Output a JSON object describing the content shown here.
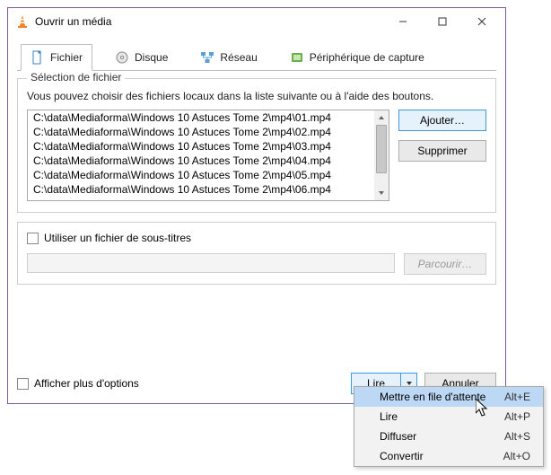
{
  "window": {
    "title": "Ouvrir un média"
  },
  "tabs": {
    "file": "Fichier",
    "disc": "Disque",
    "network": "Réseau",
    "capture": "Périphérique de capture"
  },
  "file_section": {
    "legend": "Sélection de fichier",
    "hint": "Vous pouvez choisir des fichiers locaux dans la liste suivante ou à l'aide des boutons.",
    "items": [
      "C:\\data\\Mediaforma\\Windows 10 Astuces Tome 2\\mp4\\01.mp4",
      "C:\\data\\Mediaforma\\Windows 10 Astuces Tome 2\\mp4\\02.mp4",
      "C:\\data\\Mediaforma\\Windows 10 Astuces Tome 2\\mp4\\03.mp4",
      "C:\\data\\Mediaforma\\Windows 10 Astuces Tome 2\\mp4\\04.mp4",
      "C:\\data\\Mediaforma\\Windows 10 Astuces Tome 2\\mp4\\05.mp4",
      "C:\\data\\Mediaforma\\Windows 10 Astuces Tome 2\\mp4\\06.mp4"
    ],
    "add_btn": "Ajouter…",
    "remove_btn": "Supprimer"
  },
  "subtitle_section": {
    "checkbox_label": "Utiliser un fichier de sous-titres",
    "browse_btn": "Parcourir…"
  },
  "more_options_label": "Afficher plus d'options",
  "footer": {
    "play_btn": "Lire",
    "cancel_btn": "Annuler"
  },
  "menu": {
    "items": [
      {
        "label": "Mettre en file d'attente",
        "shortcut": "Alt+E"
      },
      {
        "label": "Lire",
        "shortcut": "Alt+P"
      },
      {
        "label": "Diffuser",
        "shortcut": "Alt+S"
      },
      {
        "label": "Convertir",
        "shortcut": "Alt+O"
      }
    ]
  }
}
